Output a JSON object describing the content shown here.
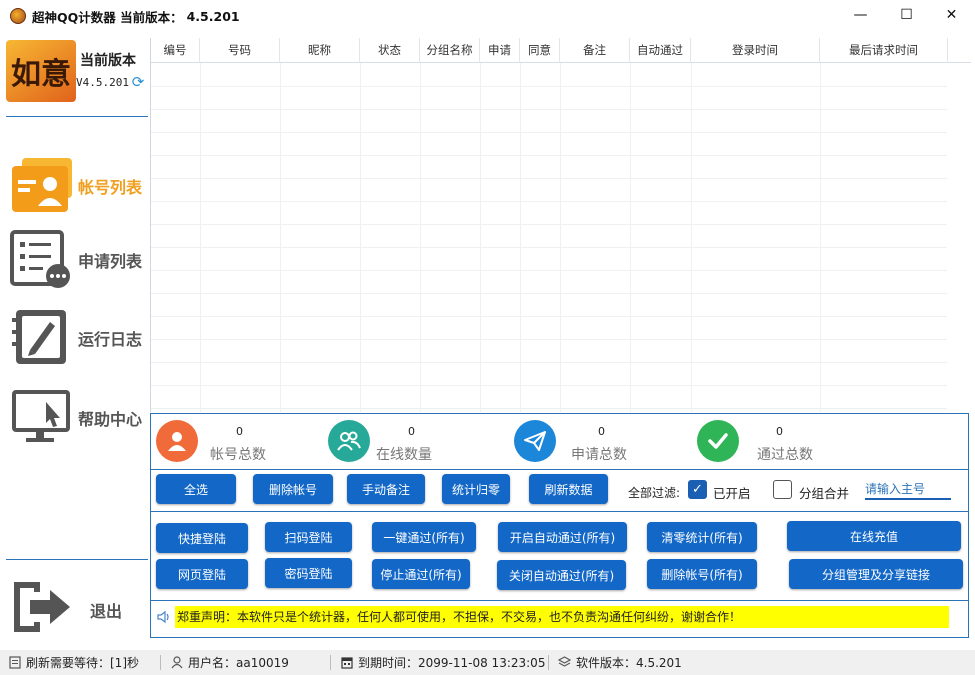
{
  "window": {
    "title": "超神QQ计数器 当前版本：",
    "version": "4.5.201",
    "min_glyph": "—",
    "max_glyph": "☐",
    "close_glyph": "✕"
  },
  "sidebar": {
    "logo_text": "如意",
    "version_title": "当前版本",
    "version_num": "V4.5.201",
    "items": [
      {
        "label": "帐号列表",
        "icon": "account-list-icon",
        "active": true
      },
      {
        "label": "申请列表",
        "icon": "request-list-icon",
        "active": false
      },
      {
        "label": "运行日志",
        "icon": "log-book-icon",
        "active": false
      },
      {
        "label": "帮助中心",
        "icon": "monitor-help-icon",
        "active": false
      }
    ],
    "exit_label": "退出"
  },
  "grid": {
    "columns": [
      "编号",
      "号码",
      "昵称",
      "状态",
      "分组名称",
      "申请",
      "同意",
      "备注",
      "自动通过",
      "登录时间",
      "最后请求时间"
    ]
  },
  "stats": [
    {
      "value": "0",
      "label": "帐号总数",
      "color": "#f06a3a",
      "icon": "user-icon"
    },
    {
      "value": "0",
      "label": "在线数量",
      "color": "#27a99a",
      "icon": "users-icon"
    },
    {
      "value": "0",
      "label": "申请总数",
      "color": "#1c86d9",
      "icon": "paper-plane-icon"
    },
    {
      "value": "0",
      "label": "通过总数",
      "color": "#2fb457",
      "icon": "check-icon"
    }
  ],
  "toolbar": {
    "select_all": "全选",
    "delete_account": "删除帐号",
    "manual_note": "手动备注",
    "reset_stats": "统计归零",
    "refresh_data": "刷新数据",
    "filter_all": "全部过滤:",
    "enabled_label": "已开启",
    "enabled_checked": true,
    "group_merge_label": "分组合并",
    "group_merge_checked": false,
    "main_qq_placeholder": "请输入主号"
  },
  "actions": {
    "quick_login": "快捷登陆",
    "scan_login": "扫码登陆",
    "approve_all": "一键通过(所有)",
    "enable_auto_all": "开启自动通过(所有)",
    "clear_stats_all": "清零统计(所有)",
    "online_recharge": "在线充值",
    "web_login": "网页登陆",
    "password_login": "密码登陆",
    "stop_approve_all": "停止通过(所有)",
    "disable_auto_all": "关闭自动通过(所有)",
    "delete_accounts_all": "删除帐号(所有)",
    "group_share": "分组管理及分享链接"
  },
  "notice": "郑重声明：本软件只是个统计器，任何人都可使用，不担保，不交易，也不负责沟通任何纠纷，谢谢合作！",
  "status": {
    "refresh_wait": "刷新需要等待：[1]秒",
    "username": "用户名：aa10019",
    "expire": "到期时间：2099-11-08 13:23:05",
    "soft_version": "软件版本：4.5.201"
  },
  "colors": {
    "accent": "#1267c7",
    "active_nav": "#f0a020",
    "notice_bg": "#ffff00"
  }
}
